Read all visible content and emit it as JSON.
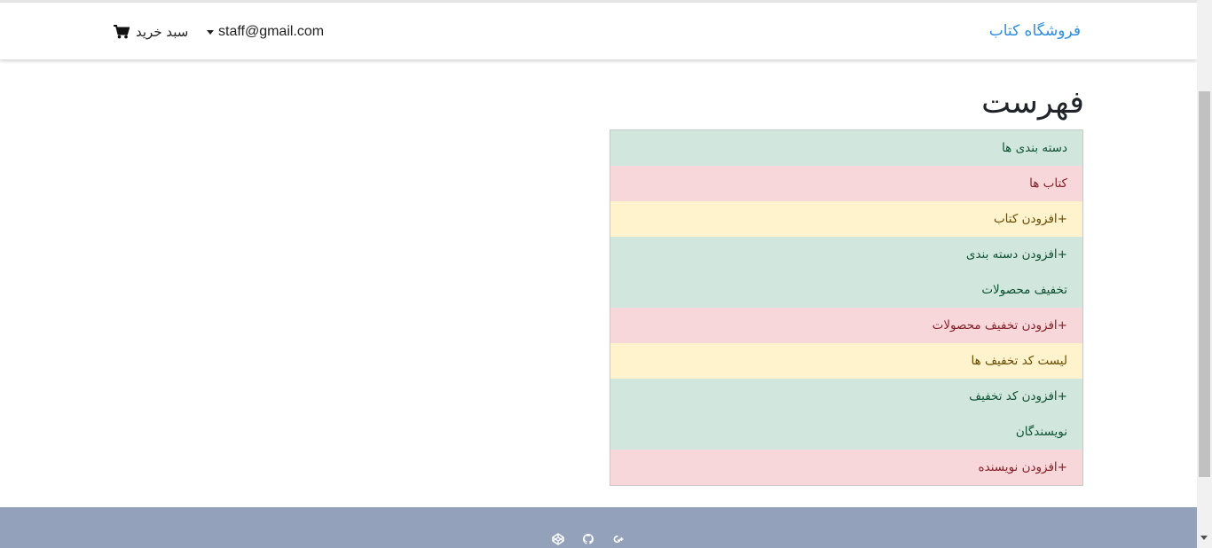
{
  "navbar": {
    "brand": "فروشگاه کتاب",
    "user_email": "staff@gmail.com",
    "cart_label": "سبد خرید"
  },
  "page": {
    "title": "فهرست"
  },
  "menu": {
    "items": [
      {
        "label": "دسته بندی ها",
        "color": "#d1e7dd"
      },
      {
        "label": "کتاب ها",
        "color": "#f8d7da"
      },
      {
        "label": "+افزودن کتاب",
        "color": "#fff3cd"
      },
      {
        "label": "+افزودن دسته بندی",
        "color": "#d1e7dd"
      },
      {
        "label": "تخفیف محصولات",
        "color": "#d1e7dd"
      },
      {
        "label": "+افزودن تخفیف محصولات",
        "color": "#f8d7da"
      },
      {
        "label": "لیست کد تخفیف ها",
        "color": "#fff3cd"
      },
      {
        "label": "+افزودن کد تخفیف",
        "color": "#d1e7dd"
      },
      {
        "label": "نویسندگان",
        "color": "#d1e7dd"
      },
      {
        "label": "+افزودن نویسنده",
        "color": "#f8d7da"
      }
    ]
  },
  "footer": {
    "icons": [
      "codepen-icon",
      "github-icon",
      "google-plus-icon"
    ],
    "background": "#93a1bb"
  },
  "colors": {
    "brand": "#2e8fe0"
  }
}
